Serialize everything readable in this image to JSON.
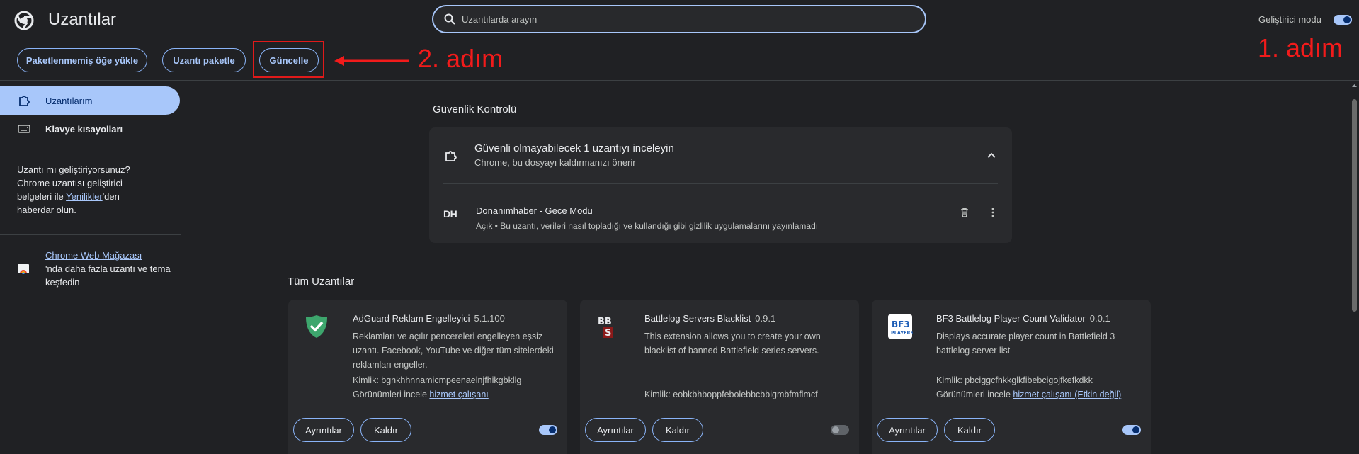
{
  "header": {
    "title": "Uzantılar",
    "search_placeholder": "Uzantılarda arayın",
    "developer_mode_label": "Geliştirici modu",
    "developer_mode_on": true
  },
  "toolbar": {
    "load_unpacked": "Paketlenmemiş öğe yükle",
    "pack_extension": "Uzantı paketle",
    "update": "Güncelle"
  },
  "annotations": {
    "step1": "1. adım",
    "step2": "2. adım",
    "color": "#f21b1b"
  },
  "sidebar": {
    "items": [
      {
        "label": "Uzantılarım",
        "icon": "puzzle-icon",
        "active": true
      },
      {
        "label": "Klavye kısayolları",
        "icon": "keyboard-icon",
        "active": false
      }
    ],
    "dev_text_1": "Uzantı mı geliştiriyorsunuz? Chrome uzantısı geliştirici belgeleri ile ",
    "dev_link": "Yenilikler",
    "dev_text_2": "'den haberdar olun.",
    "store_link": "Chrome Web Mağazası",
    "store_text": "'nda daha fazla uzantı ve tema keşfedin"
  },
  "security": {
    "section_title": "Güvenlik Kontrolü",
    "title": "Güvenli olmayabilecek 1 uzantıyı inceleyin",
    "subtitle": "Chrome, bu dosyayı kaldırmanızı önerir",
    "item": {
      "logo": "DH",
      "name": "Donanımhaber - Gece Modu",
      "description": "Açık • Bu uzantı, verileri nasıl topladığı ve kullandığı gibi gizlilik uygulamalarını yayınlamadı"
    }
  },
  "all_extensions": {
    "section_title": "Tüm Uzantılar",
    "details_label": "Ayrıntılar",
    "remove_label": "Kaldır",
    "views_label": "Görünümleri incele",
    "cards": [
      {
        "name": "AdGuard Reklam Engelleyici",
        "version": "5.1.100",
        "description": "Reklamları ve açılır pencereleri engelleyen eşsiz uzantı. Facebook, YouTube ve diğer tüm sitelerdeki reklamları engeller.",
        "id": "Kimlik: bgnkhhnnamicmpeenaelnjfhikgbkllg",
        "views_link": "hizmet çalışanı",
        "enabled": true
      },
      {
        "name": "Battlelog Servers Blacklist",
        "version": "0.9.1",
        "description": "This extension allows you to create your own blacklist of banned Battlefield series servers.",
        "id": "Kimlik: eobkbhboppfebolebbcbbigmbfmflmcf",
        "views_link": "",
        "enabled": false
      },
      {
        "name": "BF3 Battlelog Player Count Validator",
        "version": "0.0.1",
        "description": "Displays accurate player count in Battlefield 3 battlelog server list",
        "id": "Kimlik: pbciggcfhkkglkfibebcigojfkefkdkk",
        "views_link": "hizmet çalışanı (Etkin değil)",
        "enabled": true
      }
    ]
  }
}
